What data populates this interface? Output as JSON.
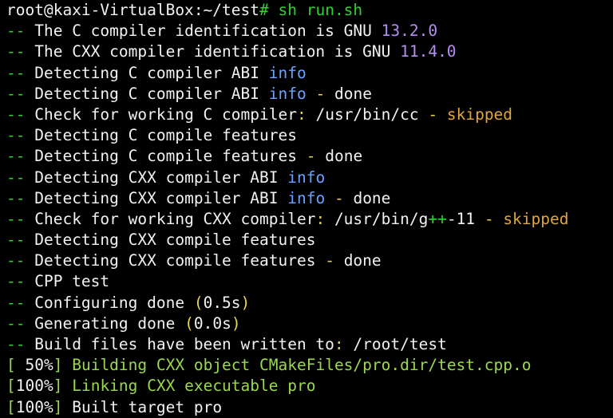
{
  "prompt": {
    "user_host": "root@kaxi-VirtualBox",
    "path": ":~/test",
    "symbol": "#",
    "command": "sh run.sh"
  },
  "output": {
    "prefix": "--",
    "c_id": {
      "text": "The C compiler identification is GNU",
      "version": "13.2.0"
    },
    "cxx_id": {
      "text": "The CXX compiler identification is GNU",
      "version": "11.4.0"
    },
    "c_abi": {
      "text": "Detecting C compiler ABI",
      "info": "info"
    },
    "c_abi_done": {
      "text": "Detecting C compiler ABI",
      "info": "info",
      "dash": "-",
      "done": "done"
    },
    "c_check": {
      "text_a": "Check for working C compiler",
      "colon": ":",
      "path": "/usr/bin/cc",
      "dash": "-",
      "status": "skipped"
    },
    "c_feat": {
      "text": "Detecting C compile features"
    },
    "c_feat_done": {
      "text": "Detecting C compile features",
      "dash": "-",
      "done": "done"
    },
    "cxx_abi": {
      "text": "Detecting CXX compiler ABI",
      "info": "info"
    },
    "cxx_abi_done": {
      "text": "Detecting CXX compiler ABI",
      "info": "info",
      "dash": "-",
      "done": "done"
    },
    "cxx_check": {
      "text_a": "Check for working CXX compiler",
      "colon": ":",
      "path_a": "/usr/bin/g",
      "plus": "++",
      "path_b": "-11",
      "dash": "-",
      "status": "skipped"
    },
    "cxx_feat": {
      "text": "Detecting CXX compile features"
    },
    "cxx_feat_done": {
      "text": "Detecting CXX compile features",
      "dash": "-",
      "done": "done"
    },
    "cpp_test": {
      "text": "CPP test"
    },
    "configuring": {
      "text": "Configuring done",
      "open": "(",
      "time": "0.5s",
      "close": ")"
    },
    "generating": {
      "text": "Generating done",
      "open": "(",
      "time": "0.0s",
      "close": ")"
    },
    "build_files": {
      "text": "Build files have been written to",
      "colon": ":",
      "path": "/root/test"
    }
  },
  "make": {
    "step1": {
      "open": "[",
      "percent": " 50%",
      "close": "]",
      "text": "Building CXX object CMakeFiles/pro.dir/test.cpp.o"
    },
    "step2": {
      "open": "[",
      "percent": "100%",
      "close": "]",
      "text": "Linking CXX executable pro"
    },
    "step3": {
      "open": "[",
      "percent": "100%",
      "close": "]",
      "text": "Built target pro"
    }
  },
  "colors": {
    "background": "#000000",
    "text": "#f2f2f2",
    "prompt_green": "#2fd12f",
    "make_green": "#9ad84f",
    "version_purple": "#b48ef2",
    "info_blue": "#6aa3ff",
    "skipped_orange": "#e2a640",
    "punct_yellow": "#e8d44d"
  }
}
